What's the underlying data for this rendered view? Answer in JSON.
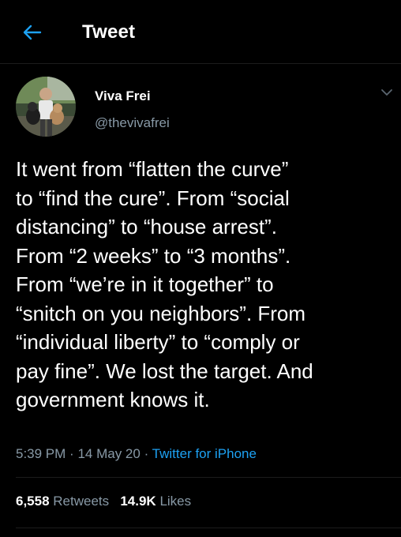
{
  "colors": {
    "background": "#000000",
    "accent": "#1da1f2",
    "secondary_text": "#8899a6",
    "divider": "#1c1c1c"
  },
  "header": {
    "back_icon": "arrow-left-icon",
    "title": "Tweet"
  },
  "author": {
    "display_name": "Viva Frei",
    "handle": "@thevivafrei",
    "more_icon": "chevron-down-icon"
  },
  "tweet": {
    "lines": [
      "It went from “flatten the curve”",
      "to “find the cure”. From “social",
      "distancing” to “house arrest”.",
      "From “2 weeks” to “3 months”.",
      "From “we’re in it together” to",
      "“snitch on you neighbors”. From",
      "“individual liberty” to “comply or",
      "pay fine”. We lost the target. And",
      "government knows it."
    ],
    "time": "5:39 PM",
    "date": "14 May 20",
    "separator": "·",
    "source": "Twitter for iPhone"
  },
  "stats": {
    "retweets_count": "6,558",
    "retweets_label": "Retweets",
    "likes_count": "14.9K",
    "likes_label": "Likes"
  }
}
